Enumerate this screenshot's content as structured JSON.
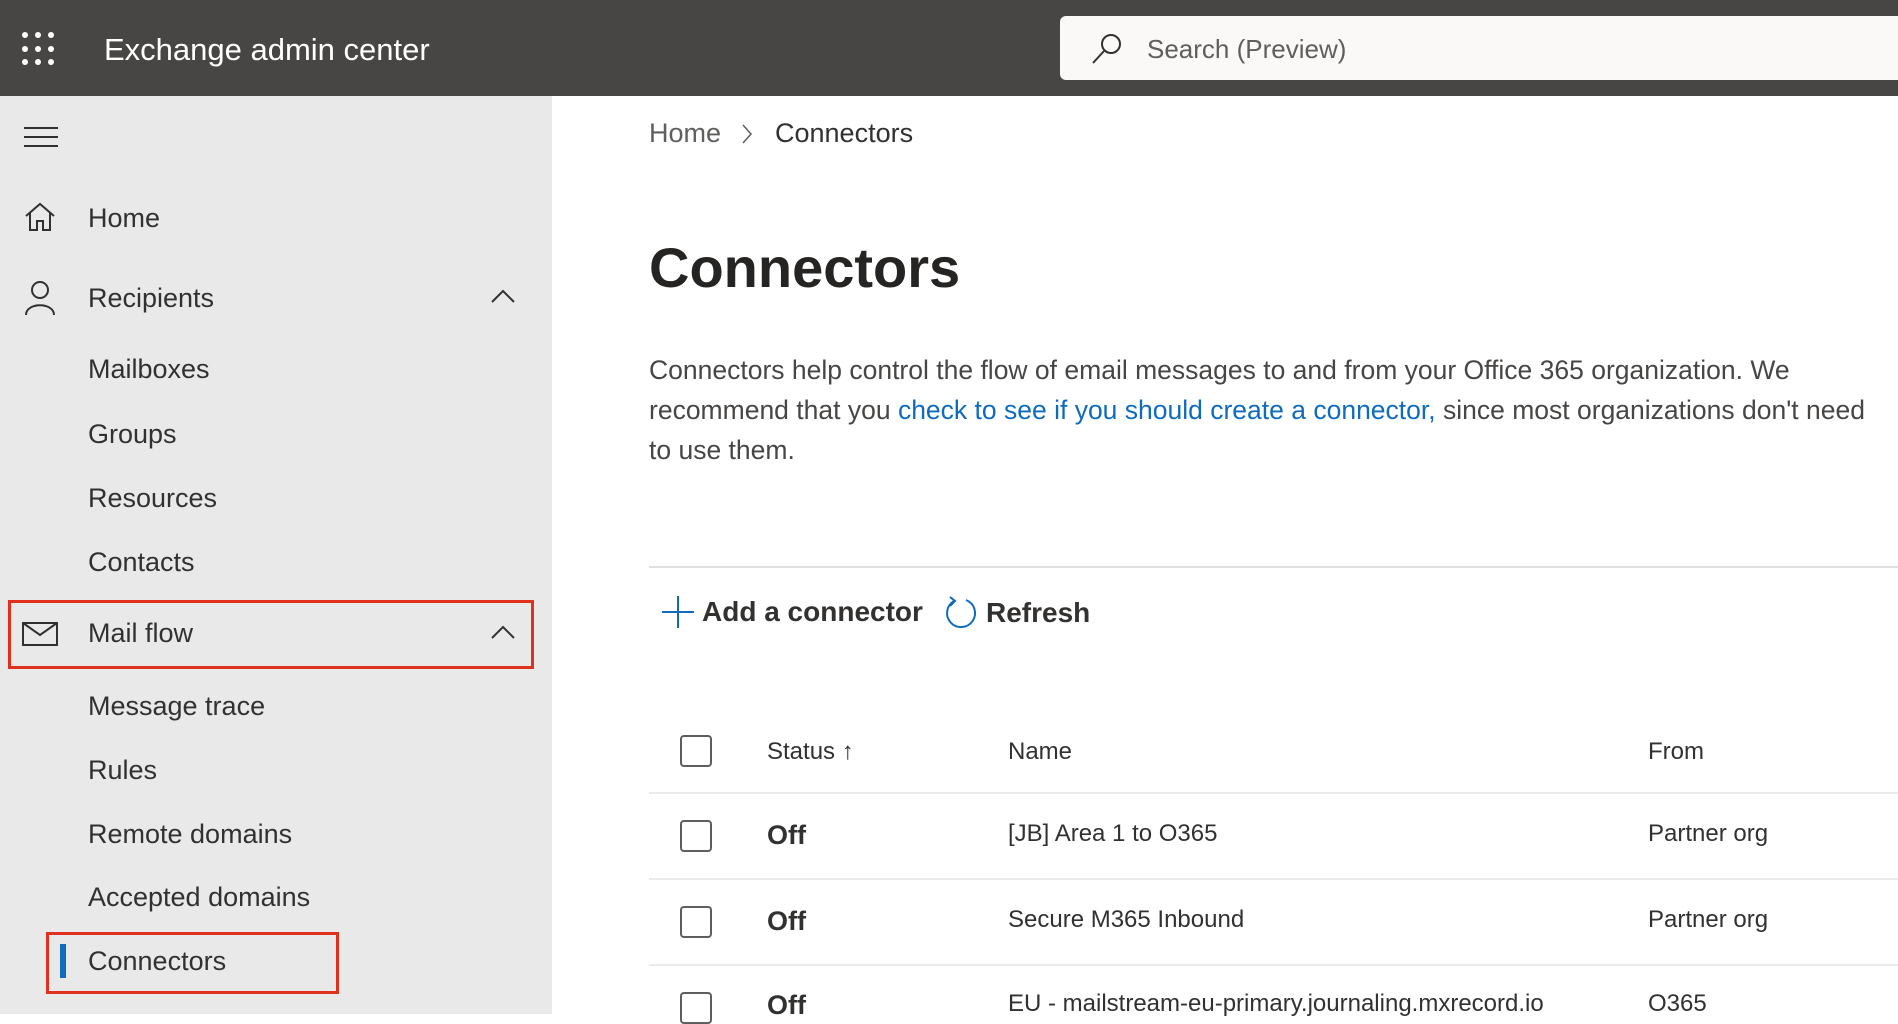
{
  "header": {
    "app_title": "Exchange admin center",
    "search_placeholder": "Search (Preview)"
  },
  "sidebar": {
    "items": [
      {
        "label": "Home",
        "icon": "home-icon"
      },
      {
        "label": "Recipients",
        "icon": "person-icon"
      },
      {
        "label": "Mailboxes"
      },
      {
        "label": "Groups"
      },
      {
        "label": "Resources"
      },
      {
        "label": "Contacts"
      },
      {
        "label": "Mail flow",
        "icon": "mail-icon"
      },
      {
        "label": "Message trace"
      },
      {
        "label": "Rules"
      },
      {
        "label": "Remote domains"
      },
      {
        "label": "Accepted domains"
      },
      {
        "label": "Connectors"
      }
    ]
  },
  "breadcrumb": {
    "home": "Home",
    "current": "Connectors"
  },
  "page": {
    "title": "Connectors",
    "desc_before": "Connectors help control the flow of email messages to and from your Office 365 organization. We recommend that you ",
    "desc_link": "check to see if you should create a connector,",
    "desc_after": " since most organizations don't need to use them."
  },
  "toolbar": {
    "add_label": "Add a connector",
    "refresh_label": "Refresh"
  },
  "table": {
    "columns": [
      "Status",
      "Name",
      "From"
    ],
    "rows": [
      {
        "status": "Off",
        "name": "[JB] Area 1 to O365",
        "from": "Partner org"
      },
      {
        "status": "Off",
        "name": "Secure M365 Inbound",
        "from": "Partner org"
      },
      {
        "status": "Off",
        "name": "EU - mailstream-eu-primary.journaling.mxrecord.io",
        "from": "O365"
      }
    ]
  },
  "colors": {
    "accent": "#0f6cbd",
    "highlight": "#e0301e",
    "topbar": "#484644"
  }
}
